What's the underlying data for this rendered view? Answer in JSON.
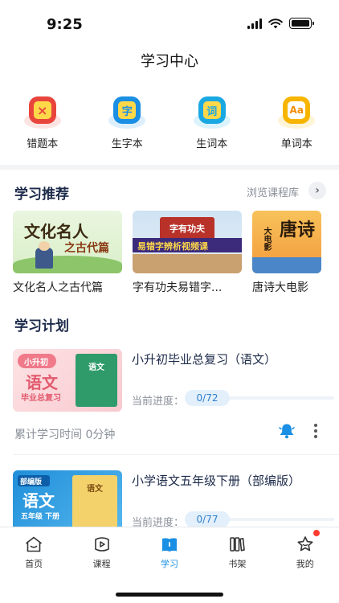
{
  "status_bar": {
    "time": "9:25"
  },
  "header": {
    "title": "学习中心"
  },
  "tools": [
    {
      "label": "错题本",
      "icon": "wrong-answer-book-icon",
      "glyph": "×",
      "color": "#e8453c",
      "shadow": "#f6b1ab"
    },
    {
      "label": "生字本",
      "icon": "new-character-book-icon",
      "glyph": "字",
      "color": "#1a8fe3",
      "shadow": "#9fd1f6"
    },
    {
      "label": "生词本",
      "icon": "new-word-book-icon",
      "glyph": "词",
      "color": "#1aa8e3",
      "shadow": "#9fdcf6"
    },
    {
      "label": "单词本",
      "icon": "vocabulary-book-icon",
      "glyph": "Aa",
      "color": "#f7b500",
      "shadow": "#fbe08a"
    }
  ],
  "recommend": {
    "title": "学习推荐",
    "browse_label": "浏览课程库",
    "items": [
      {
        "title": "文化名人之古代篇",
        "banner_line1": "文化名人",
        "banner_line2": "之古代篇"
      },
      {
        "title": "字有功夫易错字...",
        "banner_top": "字有功夫",
        "banner_main": "易错字辨析视频课"
      },
      {
        "title": "唐诗大电影",
        "banner_main": "唐诗",
        "banner_sub": "大电影"
      }
    ]
  },
  "plans": {
    "title": "学习计划",
    "progress_label": "当前进度：",
    "study_time": "累计学习时间 0分钟",
    "items": [
      {
        "title": "小升初毕业总复习（语文）",
        "progress": "0/72",
        "thumb_tag": "小升初",
        "thumb_main": "语文",
        "thumb_sub": "毕业总复习",
        "book_label": "语文"
      },
      {
        "title": "小学语文五年级下册（部编版）",
        "progress": "0/77",
        "thumb_tag": "部编版",
        "thumb_main": "语文",
        "thumb_sub": "五年级 下册",
        "book_label": "语文"
      }
    ]
  },
  "tabbar": {
    "tabs": [
      {
        "label": "首页",
        "icon": "home-icon"
      },
      {
        "label": "课程",
        "icon": "course-play-icon"
      },
      {
        "label": "学习",
        "icon": "study-book-icon",
        "active": true
      },
      {
        "label": "书架",
        "icon": "bookshelf-icon"
      },
      {
        "label": "我的",
        "icon": "profile-star-icon",
        "badge": true
      }
    ]
  },
  "colors": {
    "accent": "#1a8fe3",
    "title_dark": "#1c2a4a",
    "muted": "#8a8f99",
    "badge": "#ff3b30"
  }
}
